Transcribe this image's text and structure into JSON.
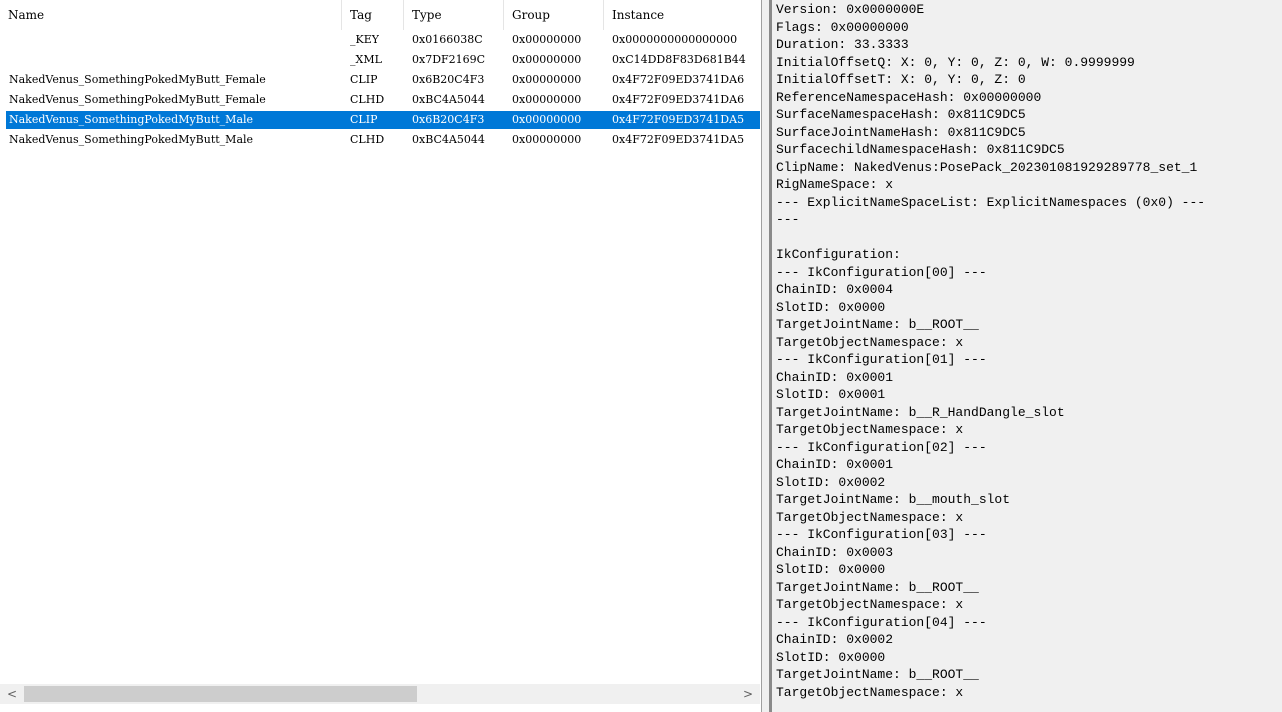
{
  "columns": [
    "Name",
    "Tag",
    "Type",
    "Group",
    "Instance"
  ],
  "rows": [
    {
      "name": "",
      "tag": "_KEY",
      "type": "0x0166038C",
      "group": "0x00000000",
      "instance": "0x0000000000000000"
    },
    {
      "name": "",
      "tag": "_XML",
      "type": "0x7DF2169C",
      "group": "0x00000000",
      "instance": "0xC14DD8F83D681B44"
    },
    {
      "name": "NakedVenus_SomethingPokedMyButt_Female",
      "tag": "CLIP",
      "type": "0x6B20C4F3",
      "group": "0x00000000",
      "instance": "0x4F72F09ED3741DA6"
    },
    {
      "name": "NakedVenus_SomethingPokedMyButt_Female",
      "tag": "CLHD",
      "type": "0xBC4A5044",
      "group": "0x00000000",
      "instance": "0x4F72F09ED3741DA6"
    },
    {
      "name": "NakedVenus_SomethingPokedMyButt_Male",
      "tag": "CLIP",
      "type": "0x6B20C4F3",
      "group": "0x00000000",
      "instance": "0x4F72F09ED3741DA5"
    },
    {
      "name": "NakedVenus_SomethingPokedMyButt_Male",
      "tag": "CLHD",
      "type": "0xBC4A5044",
      "group": "0x00000000",
      "instance": "0x4F72F09ED3741DA5"
    }
  ],
  "selected_row": 4,
  "scrollbar": {
    "left_arrow": "<",
    "right_arrow": ">"
  },
  "details_lines": [
    "Version: 0x0000000E",
    "Flags: 0x00000000",
    "Duration: 33.3333",
    "InitialOffsetQ: X: 0, Y: 0, Z: 0, W: 0.9999999",
    "InitialOffsetT: X: 0, Y: 0, Z: 0",
    "ReferenceNamespaceHash: 0x00000000",
    "SurfaceNamespaceHash: 0x811C9DC5",
    "SurfaceJointNameHash: 0x811C9DC5",
    "SurfacechildNamespaceHash: 0x811C9DC5",
    "ClipName: NakedVenus:PosePack_202301081929289778_set_1",
    "RigNameSpace: x",
    "--- ExplicitNameSpaceList: ExplicitNamespaces (0x0) ---",
    "---",
    "",
    "IkConfiguration:",
    "--- IkConfiguration[00] ---",
    "ChainID: 0x0004",
    "SlotID: 0x0000",
    "TargetJointName: b__ROOT__",
    "TargetObjectNamespace: x",
    "--- IkConfiguration[01] ---",
    "ChainID: 0x0001",
    "SlotID: 0x0001",
    "TargetJointName: b__R_HandDangle_slot",
    "TargetObjectNamespace: x",
    "--- IkConfiguration[02] ---",
    "ChainID: 0x0001",
    "SlotID: 0x0002",
    "TargetJointName: b__mouth_slot",
    "TargetObjectNamespace: x",
    "--- IkConfiguration[03] ---",
    "ChainID: 0x0003",
    "SlotID: 0x0000",
    "TargetJointName: b__ROOT__",
    "TargetObjectNamespace: x",
    "--- IkConfiguration[04] ---",
    "ChainID: 0x0002",
    "SlotID: 0x0000",
    "TargetJointName: b__ROOT__",
    "TargetObjectNamespace: x"
  ],
  "colors": {
    "selection": "#0078d7",
    "pane_bg": "#f0f0f0"
  }
}
